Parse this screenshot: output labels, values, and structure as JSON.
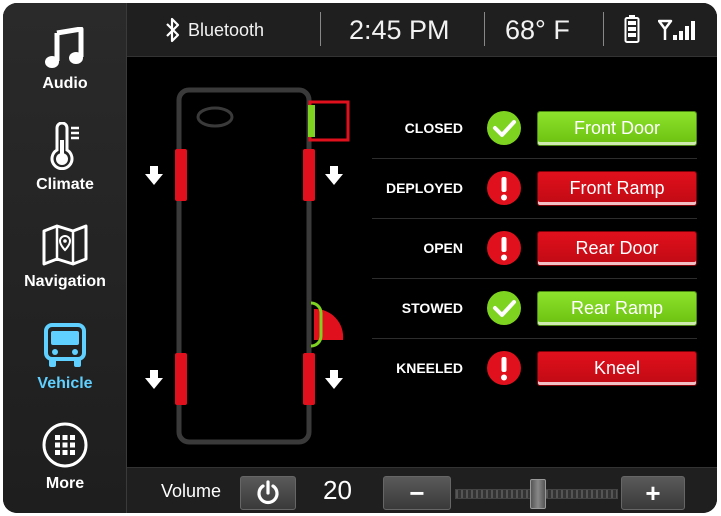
{
  "sidebar": {
    "items": [
      {
        "label": "Audio",
        "icon": "music-note-icon"
      },
      {
        "label": "Climate",
        "icon": "thermometer-icon"
      },
      {
        "label": "Navigation",
        "icon": "map-icon"
      },
      {
        "label": "Vehicle",
        "icon": "bus-icon",
        "active": true
      },
      {
        "label": "More",
        "icon": "grid-icon"
      }
    ]
  },
  "topbar": {
    "bluetooth_label": "Bluetooth",
    "time": "2:45 PM",
    "temperature": "68° F"
  },
  "status_rows": [
    {
      "status": "CLOSED",
      "state": "ok",
      "button": "Front Door",
      "button_color": "green"
    },
    {
      "status": "DEPLOYED",
      "state": "alert",
      "button": "Front Ramp",
      "button_color": "red"
    },
    {
      "status": "OPEN",
      "state": "alert",
      "button": "Rear Door",
      "button_color": "red"
    },
    {
      "status": "STOWED",
      "state": "ok",
      "button": "Rear Ramp",
      "button_color": "green"
    },
    {
      "status": "KNEELED",
      "state": "alert",
      "button": "Kneel",
      "button_color": "red"
    }
  ],
  "bottombar": {
    "volume_label": "Volume",
    "volume_value": "20",
    "minus_label": "−",
    "plus_label": "+"
  },
  "colors": {
    "ok_green": "#7ed321",
    "alert_red": "#e0101c",
    "active_blue": "#5fd0ff"
  }
}
